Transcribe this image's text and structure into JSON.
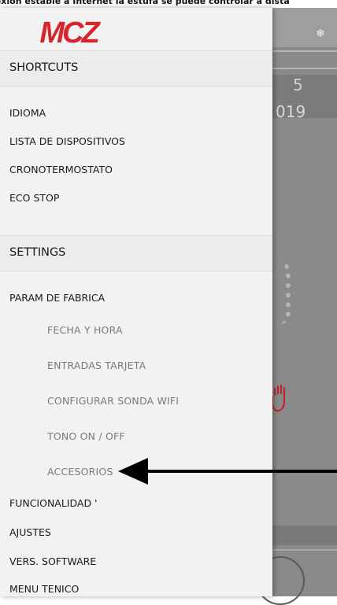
{
  "banner": {
    "text": "nexión estable a Internet la estufa se puede controlar a dista"
  },
  "background": {
    "snow_icon": "snowflake-icon",
    "partial_text_1": "5",
    "partial_text_2": "019"
  },
  "drawer": {
    "logo_text": "MCZ",
    "brand_color": "#d7262b",
    "sections": [
      {
        "label": "SHORTCUTS"
      },
      {
        "label": "SETTINGS"
      }
    ],
    "shortcuts": [
      "IDIOMA",
      "LISTA DE DISPOSITIVOS",
      "CRONOTERMOSTATO",
      "ECO STOP"
    ],
    "settings": {
      "param_de_fabrica": "PARAM DE FABRICA",
      "sub_items": [
        "FECHA Y HORA",
        "ENTRADAS TARJETA",
        "CONFIGURAR SONDA WIFI",
        "TONO ON / OFF",
        "ACCESORIOS"
      ],
      "items": [
        "FUNCIONALIDAD '",
        "AJUSTES",
        "VERS. SOFTWARE",
        "MENU TENICO"
      ]
    }
  },
  "annotation": {
    "icon": "arrow-left-icon",
    "target": "ACCESORIOS"
  }
}
